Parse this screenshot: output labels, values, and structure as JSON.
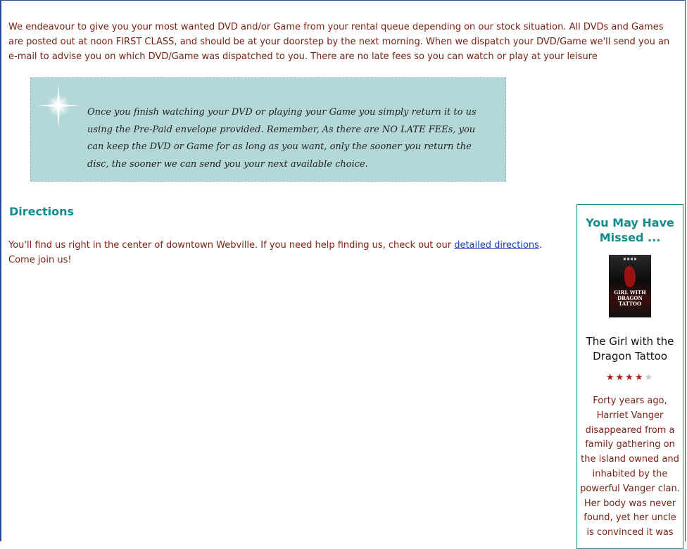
{
  "intro": {
    "text": "We endeavour to give you your most wanted DVD and/or Game from your rental queue depending on our stock situation. All DVDs and Games are posted out at noon FIRST CLASS, and should be at your doorstep by the next morning. When we dispatch your DVD/Game we'll send you an e-mail to advise you on which DVD/Game was dispatched to you. There are no late fees so you can watch or play at your leisure"
  },
  "notice": {
    "text": "Once you finish watching your DVD or playing your Game you simply return it to us using the Pre-Paid envelope provided. Remember, As there are NO LATE FEEs, you can keep the DVD or Game for as long as you want, only the sooner you return the disc, the sooner we can send you your next available choice."
  },
  "directions": {
    "heading": "Directions",
    "text_before": "You'll find us right in the center of downtown Webville. If you need help finding us, check out our ",
    "link_label": "detailed directions",
    "text_after": ". Come join us!"
  },
  "sidebar": {
    "title": "You May Have Missed ...",
    "poster_title": "GIRL WITH DRAGON TATTOO",
    "movie_title": "The Girl with the Dragon Tattoo",
    "rating": {
      "stars": 4,
      "max": 5
    },
    "blurb": "Forty years ago, Harriet Vanger disappeared from a family gathering on the island owned and inhabited by the powerful Vanger clan. Her body was never found, yet her uncle is convinced it was"
  },
  "colors": {
    "body_text": "#7a1f12",
    "heading": "#148a8a",
    "notice_bg": "#b4d7d8",
    "link": "#1a3fb5",
    "star_on": "#b21d1d",
    "star_off": "#c8c8c8"
  },
  "icons": {
    "notice_icon": "sparkle-star-icon",
    "rating_icon": "star-icon"
  }
}
